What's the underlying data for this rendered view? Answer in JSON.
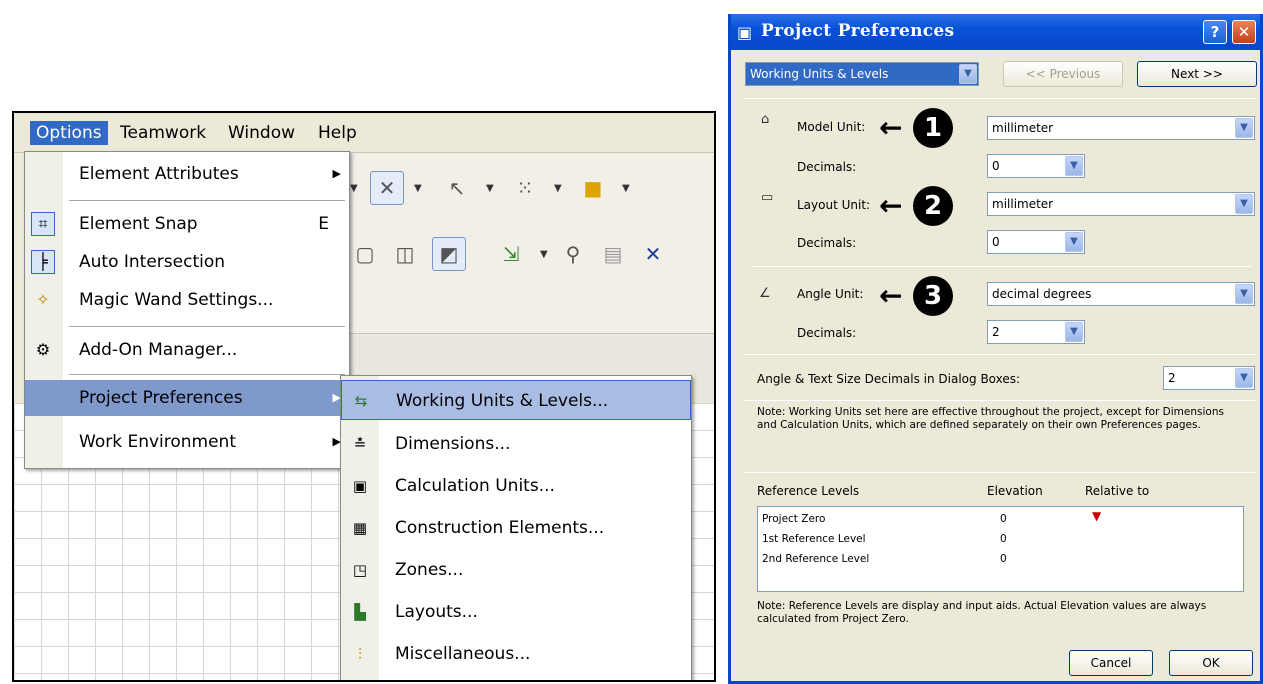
{
  "menubar": {
    "items": [
      "Options",
      "Teamwork",
      "Window",
      "Help"
    ]
  },
  "options_menu": {
    "items": [
      {
        "label": "Element Attributes",
        "has_submenu": true
      },
      {
        "label": "Element Snap",
        "shortcut": "E"
      },
      {
        "label": "Auto Intersection"
      },
      {
        "label": "Magic Wand Settings..."
      },
      {
        "label": "Add-On Manager..."
      },
      {
        "label": "Project Preferences",
        "has_submenu": true
      },
      {
        "label": "Work Environment",
        "has_submenu": true
      }
    ]
  },
  "submenu": {
    "items": [
      {
        "label": "Working Units & Levels..."
      },
      {
        "label": "Dimensions..."
      },
      {
        "label": "Calculation Units..."
      },
      {
        "label": "Construction Elements..."
      },
      {
        "label": "Zones..."
      },
      {
        "label": "Layouts..."
      },
      {
        "label": "Miscellaneous..."
      }
    ]
  },
  "dialog": {
    "title": "Project Preferences",
    "page_select": "Working Units & Levels",
    "prev_label": "<< Previous",
    "next_label": "Next >>",
    "model_unit_label": "Model Unit:",
    "model_unit_value": "millimeter",
    "decimals_label": "Decimals:",
    "model_decimals": "0",
    "layout_unit_label": "Layout Unit:",
    "layout_unit_value": "millimeter",
    "layout_decimals": "0",
    "angle_unit_label": "Angle Unit:",
    "angle_unit_value": "decimal degrees",
    "angle_decimals": "2",
    "callouts": [
      "1",
      "2",
      "3"
    ],
    "angle_text_label": "Angle & Text Size Decimals in Dialog Boxes:",
    "angle_text_value": "2",
    "note1": "Note: Working Units set here are effective throughout the project, except for Dimensions and Calculation Units, which are defined separately on their own Preferences pages.",
    "ref_levels_header": "Reference Levels",
    "elevation_header": "Elevation",
    "relative_header": "Relative to",
    "ref_rows": [
      {
        "name": "Project Zero",
        "elevation": "0"
      },
      {
        "name": "1st Reference Level",
        "elevation": "0"
      },
      {
        "name": "2nd Reference Level",
        "elevation": "0"
      }
    ],
    "note2": "Note: Reference Levels are display and input aids. Actual Elevation values are always calculated from Project Zero.",
    "cancel_label": "Cancel",
    "ok_label": "OK"
  },
  "colors": {
    "menu_highlight": "#7f99cc",
    "title_blue": "#0a46c8",
    "close_red": "#c5401a"
  }
}
